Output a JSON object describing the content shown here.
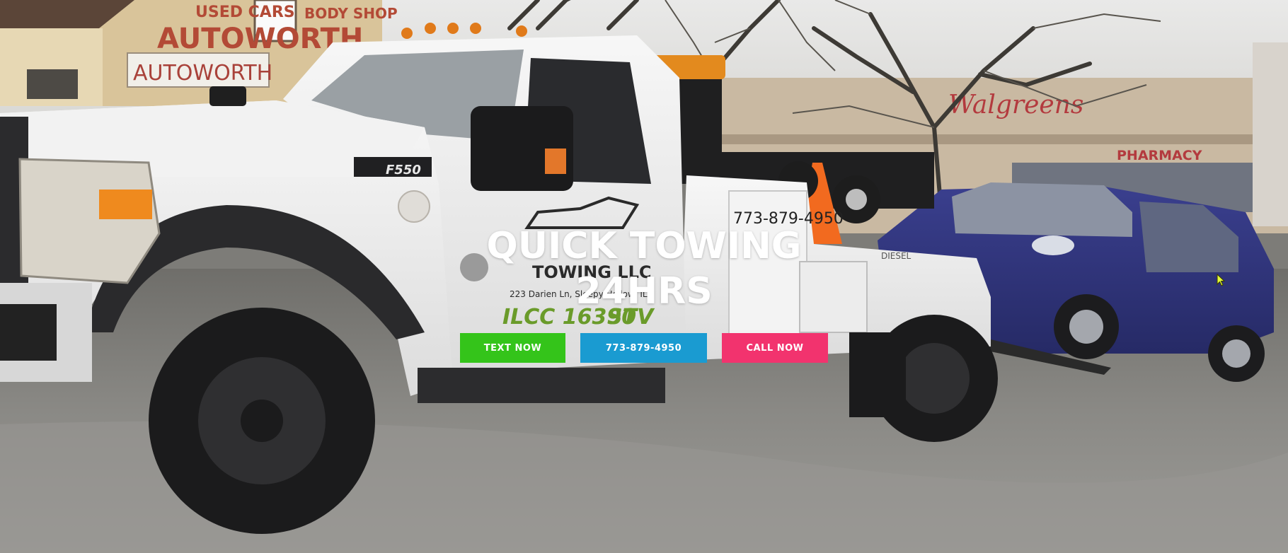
{
  "hero": {
    "background_description": "photo-tow-truck-towing-blue-suv",
    "headline_line1": "QUICK TOWING",
    "headline_line2": "24HRS"
  },
  "buttons": {
    "text_now": {
      "label": "TEXT NOW",
      "color": "#34c41a"
    },
    "phone": {
      "label": "773-879-4950",
      "color": "#1a9bd1"
    },
    "call_now": {
      "label": "CALL NOW",
      "color": "#f2336e"
    }
  },
  "photo_text": {
    "shop_sign_top": "USED CARS",
    "shop_sign_body": "BODY SHOP",
    "autoworth_large": "AUTOWORTH",
    "autoworth_small": "AUTOWORTH",
    "truck_model": "F550",
    "door_company": "TOWING LLC",
    "door_address": "223 Darien Ln, Sleepy Hollow, IL",
    "door_license": "ILCC 16390",
    "door_stv": "STV",
    "bed_phone": "773-879-4950",
    "diesel": "DIESEL",
    "pharmacy": "PHARMACY",
    "shop_script": "Walgreens"
  }
}
